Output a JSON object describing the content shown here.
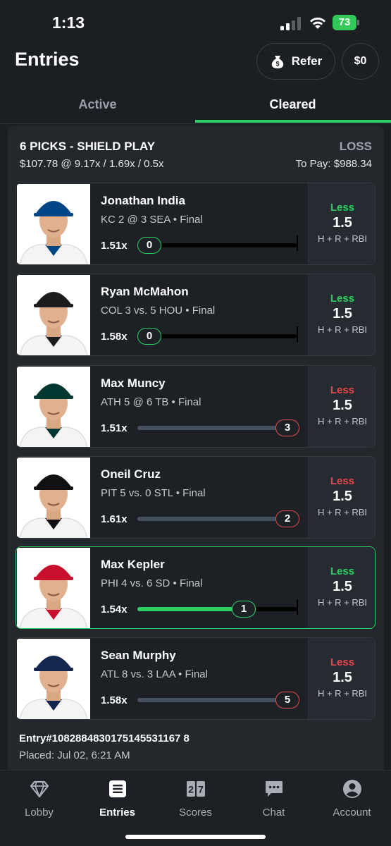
{
  "status": {
    "time": "1:13",
    "battery": "73"
  },
  "header": {
    "title": "Entries",
    "refer_label": "Refer",
    "balance": "$0"
  },
  "tabs": [
    {
      "label": "Active",
      "selected": false
    },
    {
      "label": "Cleared",
      "selected": true
    }
  ],
  "entry": {
    "title": "6 PICKS - SHIELD PLAY",
    "result": "LOSS",
    "multipliers": "$107.78 @ 9.17x / 1.69x / 0.5x",
    "to_pay": "To Pay: $988.34",
    "entry_id": "Entry #1082884830175145531167 8",
    "placed": "Placed: Jul 02, 6:21 AM",
    "picks": [
      {
        "name": "Jonathan India",
        "game": "KC 2 @ 3 SEA • Final",
        "multiplier": "1.51x",
        "value": "0",
        "progress": 0.0,
        "direction": "Less",
        "line": "1.5",
        "stat": "H + R + RBI",
        "outcome": "won",
        "team_color": "#004687"
      },
      {
        "name": "Ryan McMahon",
        "game": "COL 3 vs. 5 HOU • Final",
        "multiplier": "1.58x",
        "value": "0",
        "progress": 0.0,
        "direction": "Less",
        "line": "1.5",
        "stat": "H + R + RBI",
        "outcome": "won",
        "team_color": "#1d1d1d"
      },
      {
        "name": "Max Muncy",
        "game": "ATH 5 @ 6 TB • Final",
        "multiplier": "1.51x",
        "value": "3",
        "progress": 1.0,
        "direction": "Less",
        "line": "1.5",
        "stat": "H + R + RBI",
        "outcome": "lost",
        "team_color": "#003831"
      },
      {
        "name": "Oneil Cruz",
        "game": "PIT 5 vs. 0 STL • Final",
        "multiplier": "1.61x",
        "value": "2",
        "progress": 1.0,
        "direction": "Less",
        "line": "1.5",
        "stat": "H + R + RBI",
        "outcome": "lost",
        "team_color": "#111111"
      },
      {
        "name": "Max Kepler",
        "game": "PHI 4 vs. 6 SD • Final",
        "multiplier": "1.54x",
        "value": "1",
        "progress": 0.67,
        "direction": "Less",
        "line": "1.5",
        "stat": "H + R + RBI",
        "outcome": "won",
        "team_color": "#c8102e"
      },
      {
        "name": "Sean Murphy",
        "game": "ATL 8 vs. 3 LAA • Final",
        "multiplier": "1.58x",
        "value": "5",
        "progress": 1.0,
        "direction": "Less",
        "line": "1.5",
        "stat": "H + R + RBI",
        "outcome": "lost",
        "team_color": "#13274f"
      }
    ]
  },
  "nav": [
    {
      "label": "Lobby",
      "icon": "diamond-icon",
      "active": false
    },
    {
      "label": "Entries",
      "icon": "list-icon",
      "active": true
    },
    {
      "label": "Scores",
      "icon": "scoreboard-icon",
      "active": false
    },
    {
      "label": "Chat",
      "icon": "chat-icon",
      "active": false
    },
    {
      "label": "Account",
      "icon": "account-icon",
      "active": false
    }
  ],
  "colors": {
    "accent_green": "#2ecf62",
    "loss_red": "#e5484d",
    "background": "#1b1f24",
    "card": "#24282d"
  }
}
